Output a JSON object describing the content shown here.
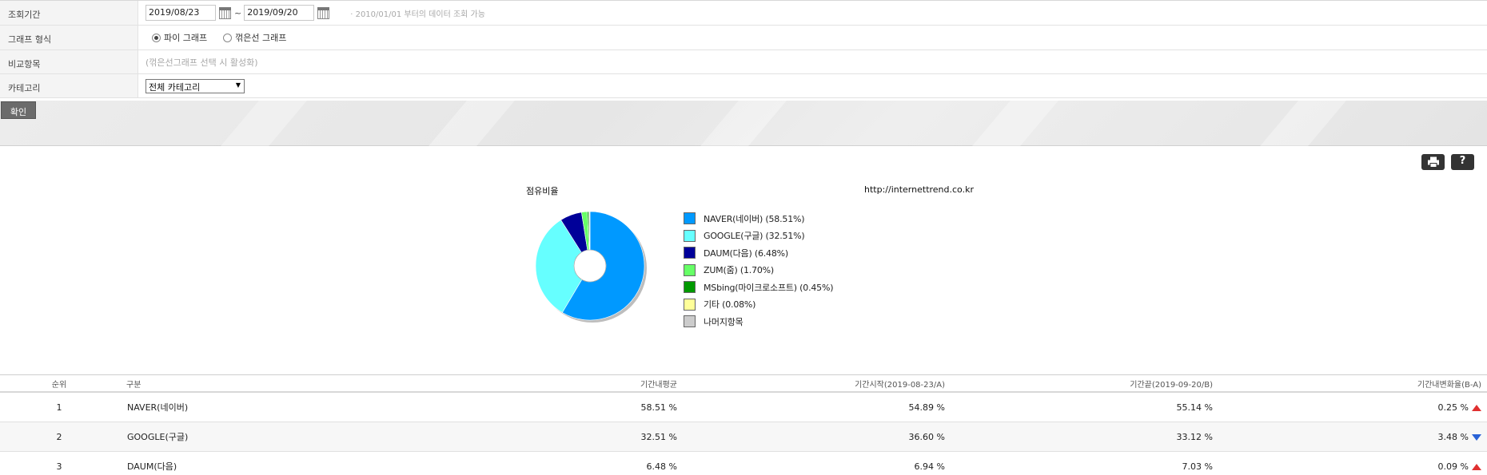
{
  "filter": {
    "period_label": "조회기간",
    "start_date": "2019/08/23",
    "end_date": "2019/09/20",
    "range_sep": "~",
    "period_note": "· 2010/01/01 부터의 데이터 조회 가능",
    "graph_type_label": "그래프 형식",
    "graph_options": [
      {
        "label": "파이 그래프",
        "selected": true
      },
      {
        "label": "꺾은선 그래프",
        "selected": false
      }
    ],
    "compare_label": "비교항목",
    "compare_note": "(꺾은선그래프 선택 시 활성화)",
    "category_label": "카테고리",
    "category_value": "전체 카테고리"
  },
  "confirm_label": "확인",
  "toolbar": {
    "print_icon": "printer-icon",
    "help_label": "?"
  },
  "chart_data": {
    "type": "pie",
    "title": "점유비율",
    "source": "http://internettrend.co.kr",
    "slices": [
      {
        "label": "NAVER(네이버)",
        "legend": "NAVER(네이버) (58.51%)",
        "value": 58.51,
        "color": "#0099ff"
      },
      {
        "label": "GOOGLE(구글)",
        "legend": "GOOGLE(구글) (32.51%)",
        "value": 32.51,
        "color": "#66ffff"
      },
      {
        "label": "DAUM(다음)",
        "legend": "DAUM(다음) (6.48%)",
        "value": 6.48,
        "color": "#000099"
      },
      {
        "label": "ZUM(줌)",
        "legend": "ZUM(줌) (1.70%)",
        "value": 1.7,
        "color": "#66ff66"
      },
      {
        "label": "MSbing(마이크로소프트)",
        "legend": "MSbing(마이크로소프트) (0.45%)",
        "value": 0.45,
        "color": "#009900"
      },
      {
        "label": "기타",
        "legend": "기타 (0.08%)",
        "value": 0.08,
        "color": "#ffff99"
      },
      {
        "label": "나머지항목",
        "legend": "나머지항목",
        "value": 0.27,
        "color": "#cccccc"
      }
    ]
  },
  "table": {
    "headers": [
      "순위",
      "구분",
      "기간내평균",
      "기간시작(2019-08-23/A)",
      "기간끝(2019-09-20/B)",
      "기간내변화율(B-A)"
    ],
    "rows": [
      {
        "rank": "1",
        "name": "NAVER(네이버)",
        "avg": "58.51 %",
        "start": "54.89 %",
        "end": "55.14 %",
        "change": "0.25 %",
        "trend": "up"
      },
      {
        "rank": "2",
        "name": "GOOGLE(구글)",
        "avg": "32.51 %",
        "start": "36.60 %",
        "end": "33.12 %",
        "change": "3.48 %",
        "trend": "down"
      },
      {
        "rank": "3",
        "name": "DAUM(다음)",
        "avg": "6.48 %",
        "start": "6.94 %",
        "end": "7.03 %",
        "change": "0.09 %",
        "trend": "up"
      }
    ]
  }
}
